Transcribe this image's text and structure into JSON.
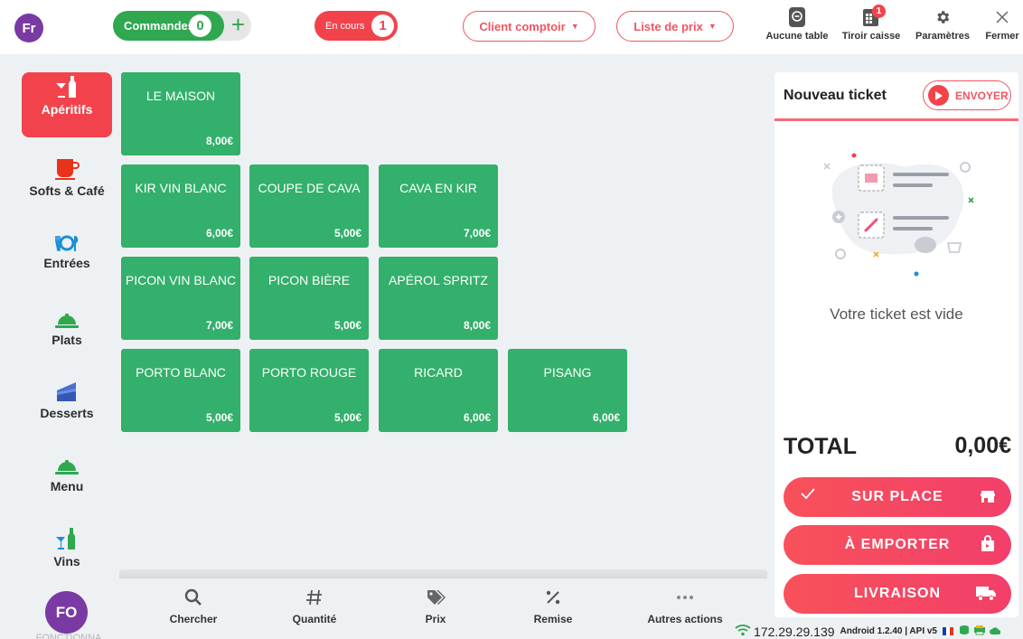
{
  "topbar": {
    "user_initials": "Fr",
    "orders": {
      "label": "Commandes",
      "count": "0",
      "add": "+"
    },
    "in_progress": {
      "label": "En cours",
      "count": "1"
    },
    "client_dropdown": "Client comptoir",
    "price_list_dropdown": "Liste de prix",
    "actions": [
      {
        "label": "Aucune table",
        "icon": "table-icon"
      },
      {
        "label": "Tiroir caisse",
        "icon": "cash-drawer-icon",
        "badge": "1"
      },
      {
        "label": "Paramètres",
        "icon": "gear-icon"
      },
      {
        "label": "Fermer",
        "icon": "close-icon"
      }
    ]
  },
  "categories": [
    {
      "label": "Apéritifs",
      "icon": "cocktail-bottle-icon",
      "active": true
    },
    {
      "label": "Softs & Café",
      "icon": "coffee-cup-icon"
    },
    {
      "label": "Entrées",
      "icon": "plate-cutlery-icon"
    },
    {
      "label": "Plats",
      "icon": "cloche-icon"
    },
    {
      "label": "Desserts",
      "icon": "cake-icon"
    },
    {
      "label": "Menu",
      "icon": "cloche-icon"
    },
    {
      "label": "Vins",
      "icon": "wine-bottle-icon"
    }
  ],
  "operator": {
    "initials": "FO",
    "caption": "FONCTIONNA"
  },
  "products": [
    {
      "name": "LE MAISON",
      "price": "8,00€"
    },
    {
      "name": "KIR VIN BLANC",
      "price": "6,00€"
    },
    {
      "name": "COUPE DE CAVA",
      "price": "5,00€"
    },
    {
      "name": "CAVA EN KIR",
      "price": "7,00€"
    },
    {
      "name": "PICON VIN BLANC",
      "price": "7,00€"
    },
    {
      "name": "PICON BIÈRE",
      "price": "5,00€"
    },
    {
      "name": "APÉROL SPRITZ",
      "price": "8,00€"
    },
    {
      "name": "PORTO BLANC",
      "price": "5,00€"
    },
    {
      "name": "PORTO ROUGE",
      "price": "5,00€"
    },
    {
      "name": "RICARD",
      "price": "6,00€"
    },
    {
      "name": "PISANG",
      "price": "6,00€"
    }
  ],
  "bottom_actions": [
    {
      "label": "Chercher",
      "icon": "search-icon"
    },
    {
      "label": "Quantité",
      "icon": "hash-icon"
    },
    {
      "label": "Prix",
      "icon": "tag-icon"
    },
    {
      "label": "Remise",
      "icon": "percent-icon"
    },
    {
      "label": "Autres actions",
      "icon": "more-icon"
    }
  ],
  "ticket": {
    "title": "Nouveau ticket",
    "send_label": "ENVOYER",
    "empty_text": "Votre ticket est vide",
    "total_label": "TOTAL",
    "total_value": "0,00€",
    "buttons": [
      {
        "label": "SUR PLACE",
        "icon": "store-icon"
      },
      {
        "label": "À EMPORTER",
        "icon": "shopping-bag-icon"
      },
      {
        "label": "LIVRAISON",
        "icon": "truck-icon"
      }
    ]
  },
  "status": {
    "ip": "172.29.29.139",
    "info": "Android 1.2.40 | API v5"
  },
  "colors": {
    "accent_red": "#f2434d",
    "product_green": "#33b06b",
    "orders_green": "#2fa84f",
    "avatar_purple": "#7a3aa3"
  }
}
